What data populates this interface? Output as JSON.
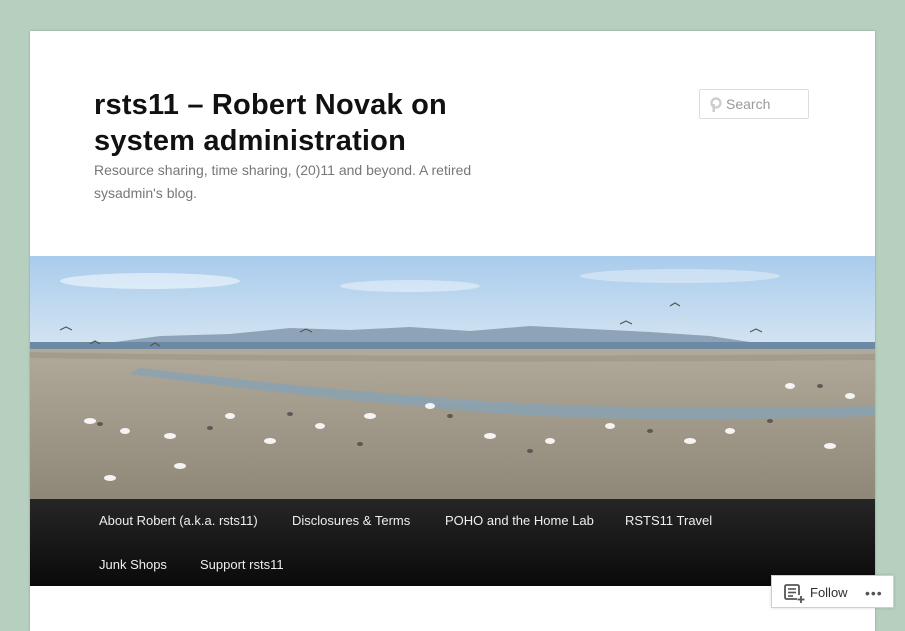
{
  "site": {
    "title": "rsts11 – Robert Novak on system administration",
    "description": "Resource sharing, time sharing, (20)11 and beyond. A retired sysadmin's blog."
  },
  "search": {
    "placeholder": "Search",
    "value": ""
  },
  "header_image": {
    "subject": "beach with seagulls and distant mountains"
  },
  "nav": {
    "items": [
      {
        "label": "About Robert (a.k.a. rsts11)"
      },
      {
        "label": "Disclosures & Terms"
      },
      {
        "label": "POHO and the Home Lab"
      },
      {
        "label": "RSTS11 Travel"
      },
      {
        "label": "Junk Shops"
      },
      {
        "label": "Support rsts11"
      }
    ]
  },
  "follow": {
    "label": "Follow",
    "more": "•••"
  },
  "colors": {
    "background": "#b7cfbf",
    "page": "#ffffff",
    "nav_bar": "#111111",
    "nav_text": "#eeeeee",
    "title": "#111111",
    "description": "#777777"
  }
}
